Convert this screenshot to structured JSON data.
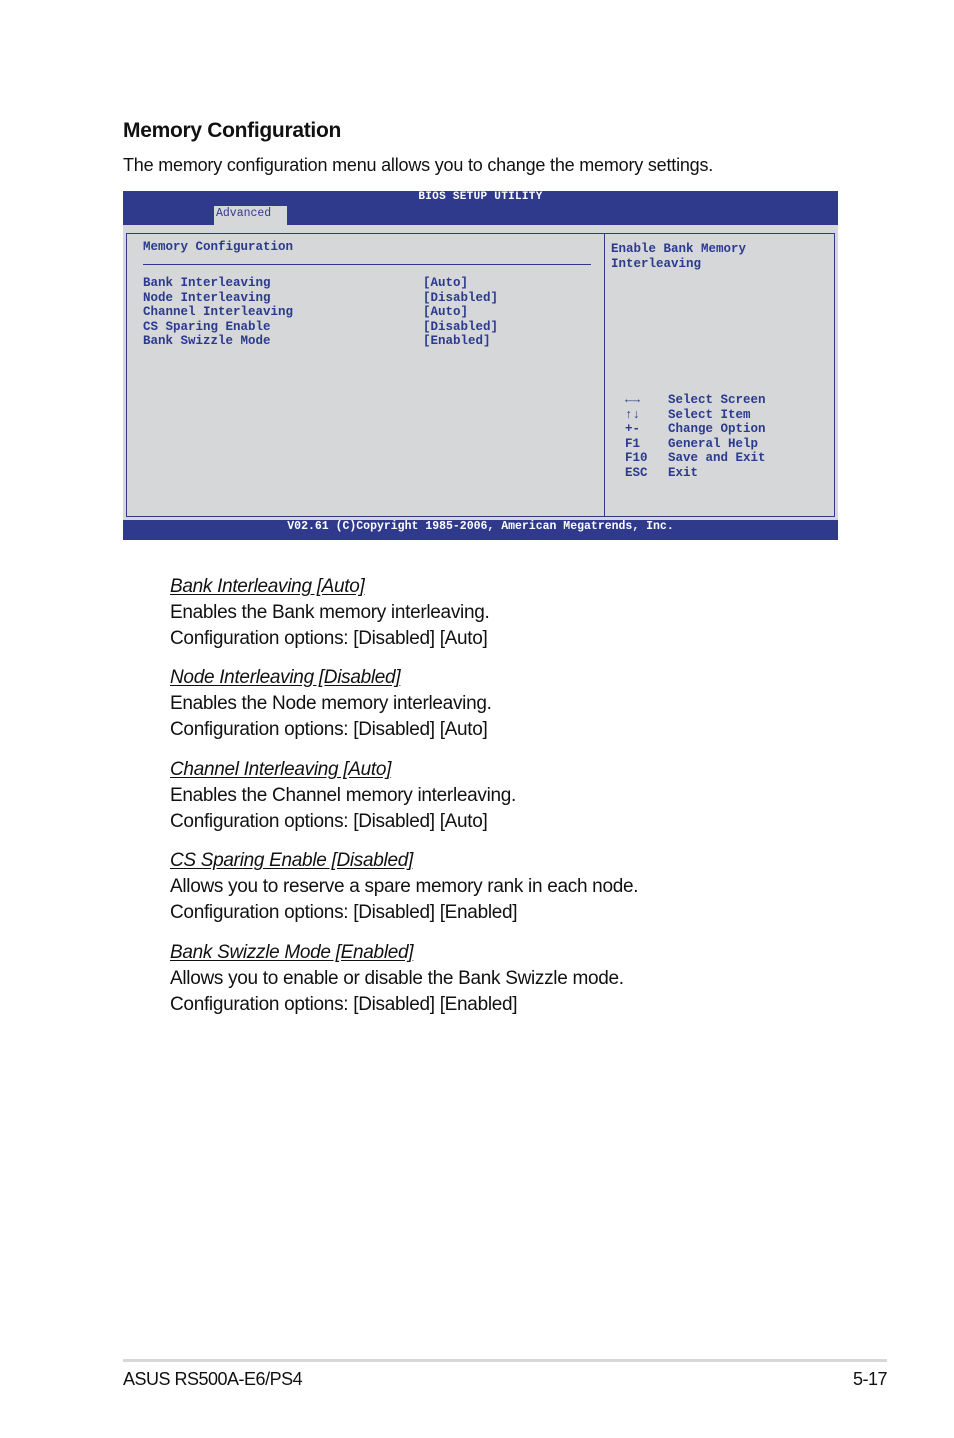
{
  "page": {
    "title": "Memory Configuration",
    "intro": "The memory configuration menu allows you to change the memory settings."
  },
  "bios": {
    "utility_title": "BIOS SETUP UTILITY",
    "active_tab": "Advanced",
    "section_title": "Memory Configuration",
    "settings": [
      {
        "label": "Bank Interleaving",
        "value": "[Auto]"
      },
      {
        "label": "Node Interleaving",
        "value": "[Disabled]"
      },
      {
        "label": "Channel Interleaving",
        "value": "[Auto]"
      },
      {
        "label": "CS Sparing Enable",
        "value": "[Disabled]"
      },
      {
        "label": "Bank Swizzle Mode",
        "value": "[Enabled]"
      }
    ],
    "help_text": "Enable Bank Memory Interleaving",
    "keys": [
      {
        "key": "←→",
        "action": "Select Screen"
      },
      {
        "key": "↑↓",
        "action": "Select Item"
      },
      {
        "key": "+-",
        "action": "Change Option"
      },
      {
        "key": "F1",
        "action": "General Help"
      },
      {
        "key": "F10",
        "action": "Save and Exit"
      },
      {
        "key": "ESC",
        "action": "Exit"
      }
    ],
    "copyright": "V02.61 (C)Copyright 1985-2006, American Megatrends, Inc.",
    "colors": {
      "bar": "#303a8c",
      "panel": "#d6d7d9",
      "text": "#2b3a8f"
    }
  },
  "descriptions": [
    {
      "heading": "Bank Interleaving [Auto]",
      "text": "Enables the Bank memory interleaving.",
      "options": "Configuration options: [Disabled] [Auto]"
    },
    {
      "heading": "Node Interleaving [Disabled]",
      "text": "Enables the Node memory interleaving.",
      "options": "Configuration options: [Disabled] [Auto]"
    },
    {
      "heading": "Channel Interleaving [Auto]",
      "text": "Enables the Channel memory interleaving.",
      "options": "Configuration options: [Disabled] [Auto]"
    },
    {
      "heading": "CS Sparing Enable [Disabled]",
      "text": "Allows you to reserve a spare memory rank in each node.",
      "options": "Configuration options: [Disabled] [Enabled]"
    },
    {
      "heading": "Bank Swizzle Mode [Enabled]",
      "text": "Allows you to enable or disable the Bank Swizzle mode.",
      "options": "Configuration options: [Disabled] [Enabled]"
    }
  ],
  "footer": {
    "product": "ASUS RS500A-E6/PS4",
    "page_number": "5-17"
  }
}
